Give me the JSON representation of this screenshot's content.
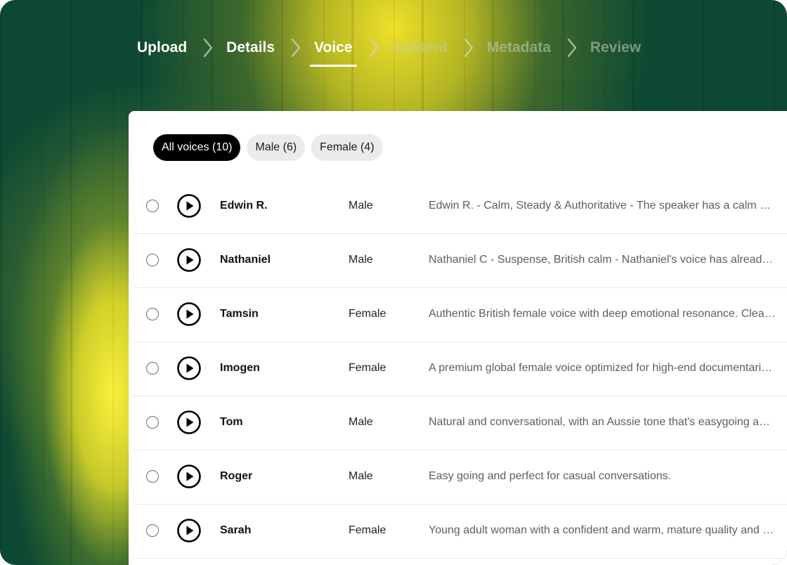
{
  "stepper": {
    "steps": [
      {
        "label": "Upload",
        "state": "done"
      },
      {
        "label": "Details",
        "state": "done"
      },
      {
        "label": "Voice",
        "state": "active"
      },
      {
        "label": "Content",
        "state": "upcoming"
      },
      {
        "label": "Metadata",
        "state": "upcoming"
      },
      {
        "label": "Review",
        "state": "upcoming"
      }
    ],
    "separator_icon": "chevron-right-icon"
  },
  "filters": [
    {
      "label": "All voices (10)",
      "selected": true
    },
    {
      "label": "Male (6)",
      "selected": false
    },
    {
      "label": "Female (4)",
      "selected": false
    }
  ],
  "voices": [
    {
      "name": "Edwin R.",
      "gender": "Male",
      "description": "Edwin R. - Calm, Steady & Authoritative - The speaker has a calm voice with a steady delivery",
      "selected": false
    },
    {
      "name": "Nathaniel",
      "gender": "Male",
      "description": "Nathaniel C - Suspense, British calm - Nathaniel's voice has already been used",
      "selected": false
    },
    {
      "name": "Tamsin",
      "gender": "Female",
      "description": "Authentic British female voice with deep emotional resonance. Clear and expressive",
      "selected": false
    },
    {
      "name": "Imogen",
      "gender": "Female",
      "description": "A premium global female voice optimized for high-end documentaries and narration",
      "selected": false
    },
    {
      "name": "Tom",
      "gender": "Male",
      "description": "Natural and conversational, with an Aussie tone that's easygoing and friendly",
      "selected": false
    },
    {
      "name": "Roger",
      "gender": "Male",
      "description": "Easy going and perfect for casual conversations.",
      "selected": false
    },
    {
      "name": "Sarah",
      "gender": "Female",
      "description": "Young adult woman with a confident and warm, mature quality and reassuring tone",
      "selected": false
    }
  ],
  "icons": {
    "play": "play-circle-icon",
    "radio": "radio-unselected-icon"
  },
  "colors": {
    "background": "#0e4a33",
    "glow": "#f0e232",
    "chip_active": "#000000",
    "chip_inactive": "#ebebeb"
  }
}
